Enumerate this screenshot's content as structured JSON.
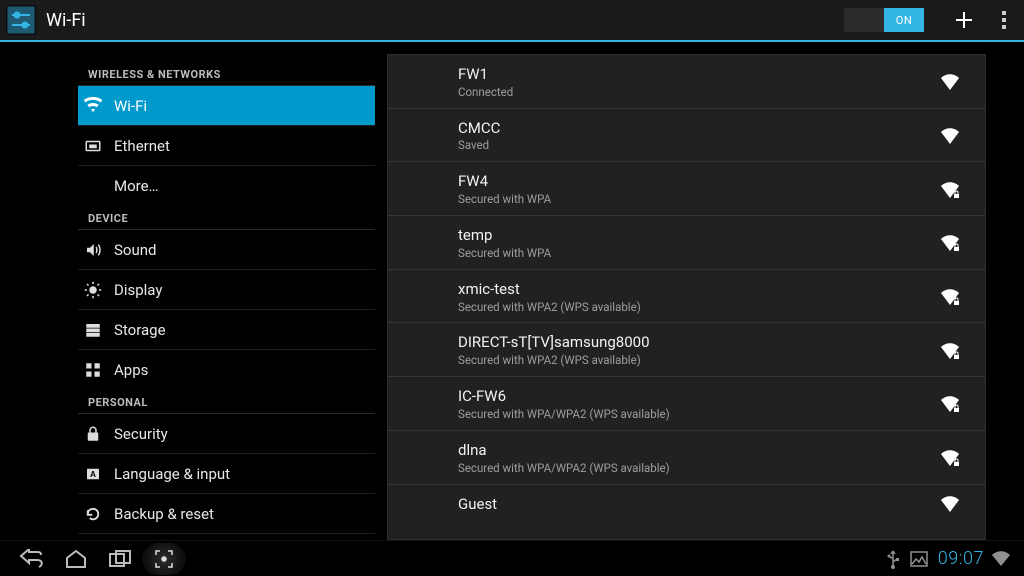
{
  "actionbar": {
    "title": "Wi-Fi",
    "switch_on_label": "ON"
  },
  "sidebar": {
    "sections": [
      {
        "label": "WIRELESS & NETWORKS",
        "items": [
          {
            "key": "wifi",
            "label": "Wi-Fi",
            "icon": "wifi",
            "active": true
          },
          {
            "key": "ethernet",
            "label": "Ethernet",
            "icon": "ethernet"
          },
          {
            "key": "more",
            "label": "More…",
            "icon": ""
          }
        ]
      },
      {
        "label": "DEVICE",
        "items": [
          {
            "key": "sound",
            "label": "Sound",
            "icon": "sound"
          },
          {
            "key": "display",
            "label": "Display",
            "icon": "display"
          },
          {
            "key": "storage",
            "label": "Storage",
            "icon": "storage"
          },
          {
            "key": "apps",
            "label": "Apps",
            "icon": "apps"
          }
        ]
      },
      {
        "label": "PERSONAL",
        "items": [
          {
            "key": "security",
            "label": "Security",
            "icon": "security"
          },
          {
            "key": "language",
            "label": "Language & input",
            "icon": "language"
          },
          {
            "key": "backup",
            "label": "Backup & reset",
            "icon": "backup"
          }
        ]
      }
    ]
  },
  "networks": [
    {
      "ssid": "FW1",
      "status": "Connected",
      "secured": false
    },
    {
      "ssid": "CMCC",
      "status": "Saved",
      "secured": false
    },
    {
      "ssid": "FW4",
      "status": "Secured with WPA",
      "secured": true
    },
    {
      "ssid": "temp",
      "status": "Secured with WPA",
      "secured": true
    },
    {
      "ssid": "xmic-test",
      "status": "Secured with WPA2 (WPS available)",
      "secured": true
    },
    {
      "ssid": "DIRECT-sT[TV]samsung8000",
      "status": "Secured with WPA2 (WPS available)",
      "secured": true
    },
    {
      "ssid": "IC-FW6",
      "status": "Secured with WPA/WPA2 (WPS available)",
      "secured": true
    },
    {
      "ssid": "dlna",
      "status": "Secured with WPA/WPA2 (WPS available)",
      "secured": true
    },
    {
      "ssid": "Guest",
      "status": "",
      "secured": false
    }
  ],
  "statusbar": {
    "time": "09:07"
  },
  "colors": {
    "accent": "#33b5e5",
    "panel_bg": "#212121",
    "side_active": "#0099cc"
  }
}
